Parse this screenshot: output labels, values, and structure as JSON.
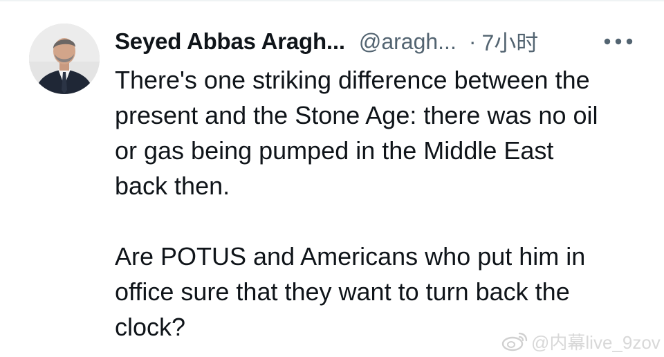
{
  "tweet": {
    "author": {
      "display_name": "Seyed Abbas Aragh...",
      "handle": "@aragh...",
      "avatar_icon": "profile-photo"
    },
    "separator": "·",
    "time": "7小时",
    "more_icon": "more-horizontal-icon",
    "paragraphs": [
      "There's one striking difference between the\npresent and the Stone Age: there was no oil\nor gas being pumped in the Middle East\nback then.",
      "Are POTUS and Americans who put him in\noffice sure that they want to turn back the\nclock?"
    ]
  },
  "watermark": {
    "icon": "weibo-icon",
    "text": "@内幕live_9zov"
  },
  "colors": {
    "text_primary": "#0f1419",
    "text_secondary": "#536471",
    "background": "#ffffff",
    "watermark": "#d8d8d8"
  }
}
